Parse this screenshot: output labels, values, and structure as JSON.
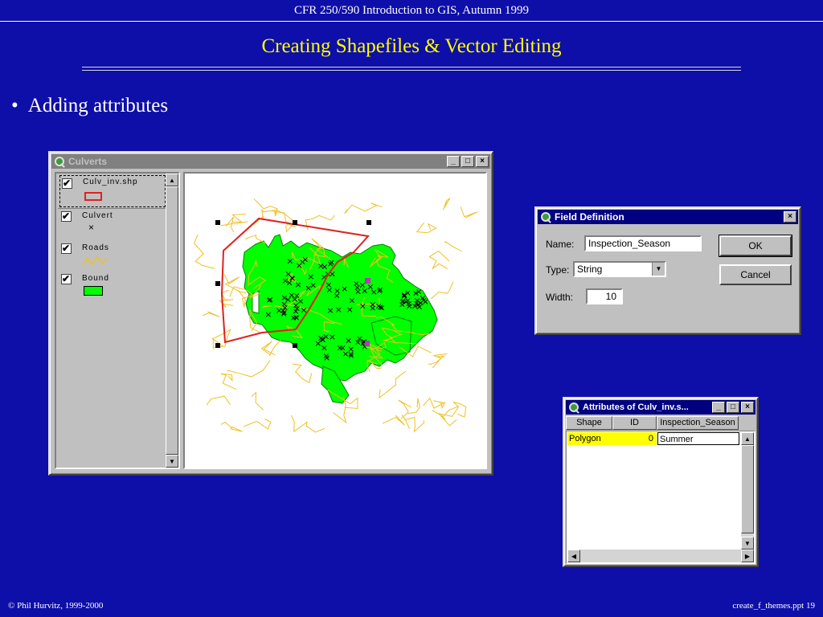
{
  "slide": {
    "course": "CFR 250/590 Introduction to GIS, Autumn 1999",
    "title": "Creating Shapefiles & Vector Editing",
    "bullet": "Adding attributes",
    "bullet_marker": "•",
    "footer_left": "© Phil Hurvitz, 1999-2000",
    "footer_right": "create_f_themes.ppt    19"
  },
  "colors": {
    "slide_bg": "#0e0ea8",
    "title": "#ffff00",
    "bound_fill": "#00ff00",
    "roads": "#f0c020",
    "selection": "#e02020",
    "highlight_row": "#ffff00"
  },
  "view_window": {
    "title": "Culverts",
    "buttons": [
      "_",
      "□",
      "×"
    ],
    "themes": [
      {
        "name": "Culv_inv.shp",
        "checked": true,
        "active": true,
        "symbol": "red-rectangle"
      },
      {
        "name": "Culvert",
        "checked": true,
        "symbol": "x"
      },
      {
        "name": "Roads",
        "checked": true,
        "symbol": "yellow-line"
      },
      {
        "name": "Bound",
        "checked": true,
        "symbol": "green-fill"
      }
    ],
    "culvert_symbol": "×",
    "check_mark": "✔"
  },
  "field_definition": {
    "title": "Field Definition",
    "close": "×",
    "name_label": "Name:",
    "name_value": "Inspection_Season",
    "type_label": "Type:",
    "type_value": "String",
    "type_arrow": "▼",
    "width_label": "Width:",
    "width_value": "10",
    "ok_label": "OK",
    "cancel_label": "Cancel"
  },
  "attributes_table": {
    "title": "Attributes of Culv_inv.s...",
    "buttons": [
      "_",
      "□",
      "×"
    ],
    "columns": [
      "Shape",
      "ID",
      "Inspection_Season"
    ],
    "rows": [
      {
        "shape": "Polygon",
        "id": "0",
        "season": "Summer"
      }
    ],
    "scroll_up": "▲",
    "scroll_down": "▼",
    "scroll_left": "◀",
    "scroll_right": "▶"
  }
}
